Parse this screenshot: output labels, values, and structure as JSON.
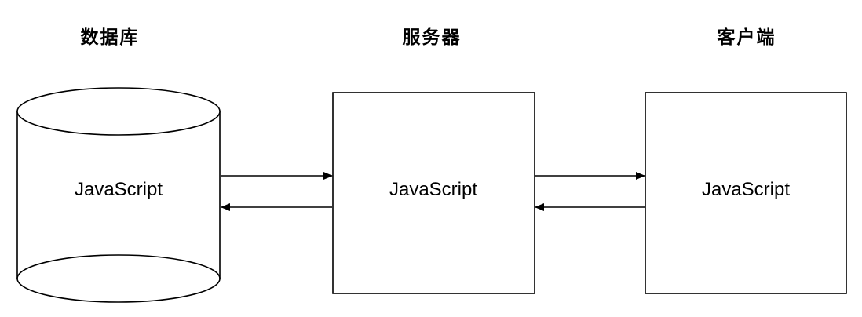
{
  "nodes": {
    "database": {
      "heading": "数据库",
      "body": "JavaScript"
    },
    "server": {
      "heading": "服务器",
      "body": "JavaScript"
    },
    "client": {
      "heading": "客户端",
      "body": "JavaScript"
    }
  },
  "colors": {
    "stroke": "#000000",
    "background": "#ffffff"
  }
}
